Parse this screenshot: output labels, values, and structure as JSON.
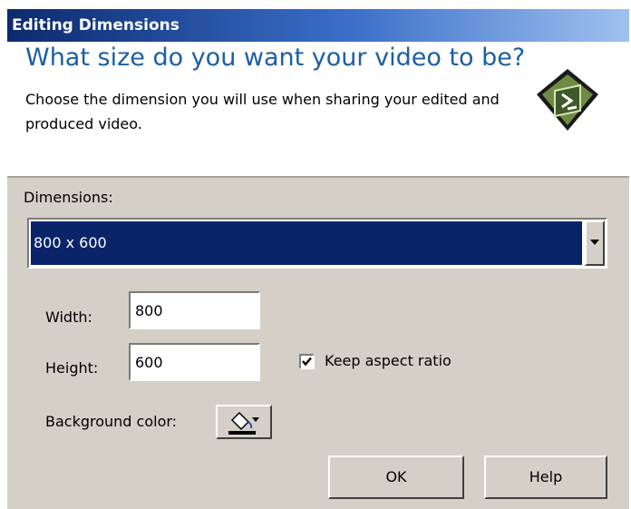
{
  "window": {
    "title": "Editing Dimensions"
  },
  "header": {
    "heading": "What size do you want your video to be?",
    "description": "Choose the dimension you will use when sharing your edited and produced video.",
    "logo_icon": "camtasia-film-icon"
  },
  "dimensions": {
    "label": "Dimensions:",
    "selected": "800 x 600",
    "arrow_icon": "chevron-down-icon"
  },
  "width": {
    "label": "Width:",
    "value": "800"
  },
  "height": {
    "label": "Height:",
    "value": "600"
  },
  "aspect": {
    "label": "Keep aspect ratio",
    "checked": true
  },
  "background": {
    "label": "Background color:",
    "icon": "paint-bucket-icon",
    "color": "#000000"
  },
  "buttons": {
    "ok": "OK",
    "help": "Help"
  },
  "colors": {
    "heading": "#1b5fa3",
    "selection": "#0a246a",
    "dialog_bg": "#d4d0c8"
  }
}
